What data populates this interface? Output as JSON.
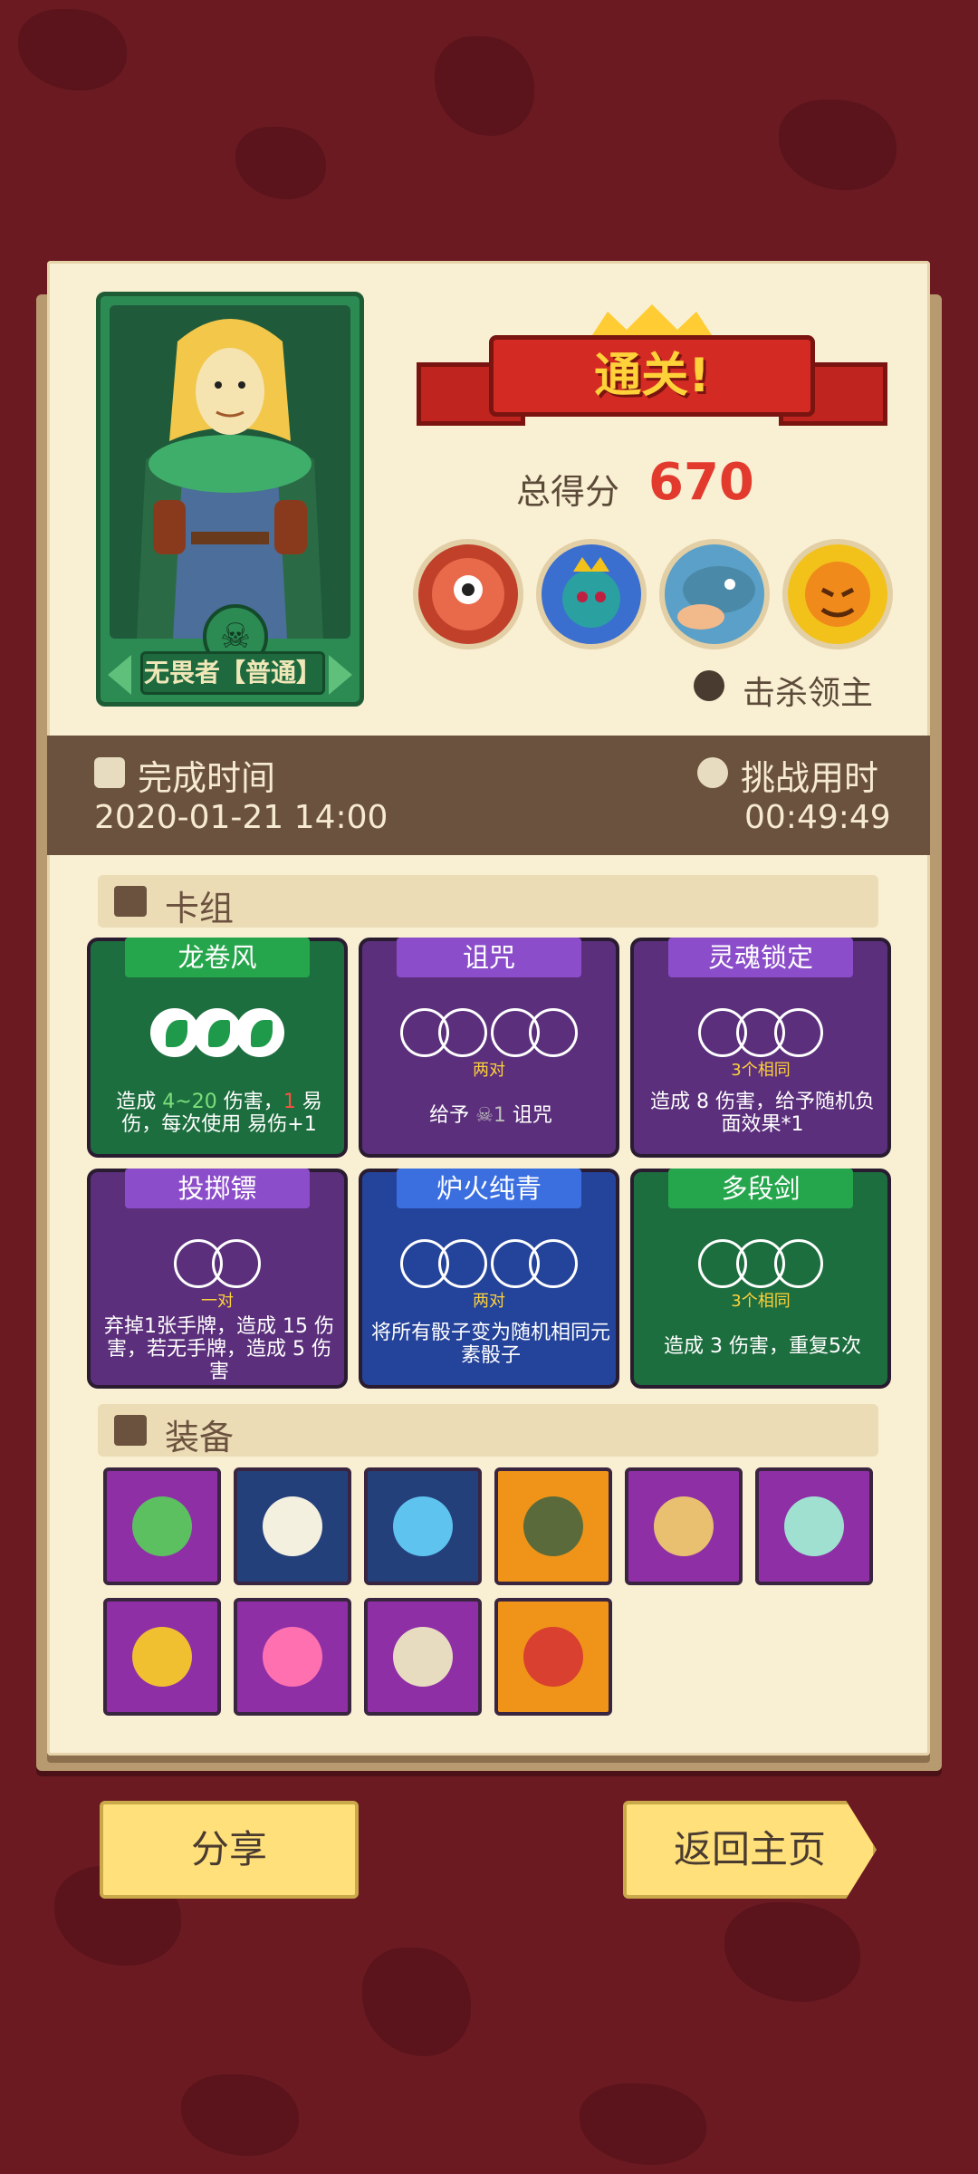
{
  "result": {
    "banner_text": "通关!",
    "score_label": "总得分",
    "score_value": "670",
    "kill_label": "击杀领主"
  },
  "hero": {
    "name": "无畏者【普通】",
    "icon": "skull-icon"
  },
  "bosses": [
    {
      "name": "eyeball-boss-icon",
      "color": "#c0402a"
    },
    {
      "name": "spider-king-boss-icon",
      "color": "#3a6fd0"
    },
    {
      "name": "fish-boss-icon",
      "color": "#5aa0c8"
    },
    {
      "name": "sun-boss-icon",
      "color": "#f2c21a"
    }
  ],
  "times": {
    "finish_label": "完成时间",
    "finish_value": "2020-01-21 14:00",
    "duration_label": "挑战用时",
    "duration_value": "00:49:49"
  },
  "deck": {
    "title": "卡组",
    "cards": [
      {
        "name": "龙卷风",
        "style": "green",
        "dice": "green3",
        "sub": "",
        "desc_parts": [
          "造成 ",
          "4~20",
          " 伤害，",
          "1",
          " 易伤，每次使用 ",
          "易伤+1"
        ]
      },
      {
        "name": "诅咒",
        "style": "purple",
        "dice": "pair2",
        "sub": "两对",
        "desc": "给予",
        "desc2": "1",
        "desc3": " 诅咒"
      },
      {
        "name": "灵魂锁定",
        "style": "purple",
        "dice": "three",
        "sub": "3个相同",
        "desc": "造成 8 伤害，给予随机负面效果*1"
      },
      {
        "name": "投掷镖",
        "style": "purple",
        "dice": "pair1",
        "sub": "一对",
        "desc": "弃掉1张手牌，造成 15 伤害，若无手牌，造成 5 伤害"
      },
      {
        "name": "炉火纯青",
        "style": "blue",
        "dice": "pair2",
        "sub": "两对",
        "desc": "将所有骰子变为随机相同元素骰子"
      },
      {
        "name": "多段剑",
        "style": "green",
        "dice": "three",
        "sub": "3个相同",
        "desc": "造成 3 伤害，重复5次"
      }
    ]
  },
  "equipment": {
    "title": "装备",
    "items": [
      {
        "name": "potion-flask-icon",
        "bg": "#8e2fa6",
        "fg": "#5cc060"
      },
      {
        "name": "skull-icon",
        "bg": "#23407a",
        "fg": "#f4f0e0"
      },
      {
        "name": "ice-crown-icon",
        "bg": "#23407a",
        "fg": "#5fc3ef"
      },
      {
        "name": "goblin-mask-icon",
        "bg": "#ef9418",
        "fg": "#5a6a3a"
      },
      {
        "name": "spellbook-icon",
        "bg": "#8e2fa6",
        "fg": "#e8c070"
      },
      {
        "name": "vase-icon",
        "bg": "#8e2fa6",
        "fg": "#a0e0d0"
      },
      {
        "name": "heart-shield-icon",
        "bg": "#8e2fa6",
        "fg": "#f0c030"
      },
      {
        "name": "totem-icon",
        "bg": "#8e2fa6",
        "fg": "#ff70b0"
      },
      {
        "name": "scroll-icon",
        "bg": "#8e2fa6",
        "fg": "#e8dcc0"
      },
      {
        "name": "dagger-scroll-icon",
        "bg": "#ef9418",
        "fg": "#d94030"
      }
    ]
  },
  "buttons": {
    "share": "分享",
    "home": "返回主页"
  }
}
